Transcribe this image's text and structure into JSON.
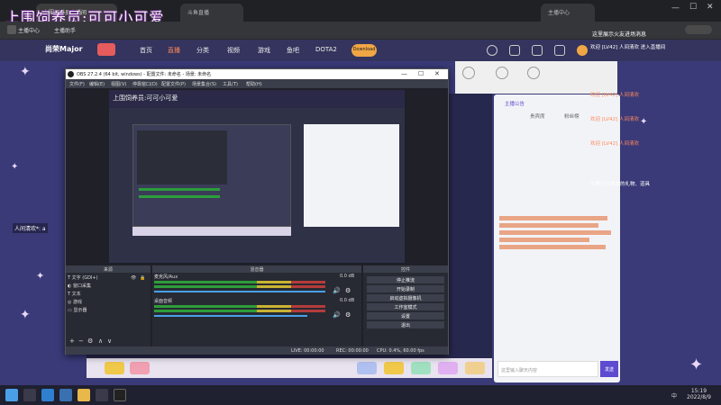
{
  "watermark": "上围饲养员:可可小可爱",
  "browser": {
    "tabs": [
      "上围饲养员直播间",
      "斗鱼直播",
      "主播中心"
    ],
    "bookmarks": [
      "主播中心",
      "主播助手"
    ],
    "address": "douyu.com"
  },
  "site_nav": {
    "logo": "尚荣Major",
    "links": [
      "首页",
      "直播",
      "分类",
      "视频",
      "游戏",
      "鱼吧",
      "DOTA2"
    ],
    "download_label": "Download"
  },
  "chat": {
    "tabs": [
      "主播公告",
      "贵宾席",
      "粉丝榜"
    ],
    "notice": "这里展示火友进场消息",
    "join_lines": [
      "欢迎 [LV42] 人间清欢 进入直播间",
      "欢迎 [LV42] 人间清欢",
      "欢迎 [LV42] 人间清欢",
      "欢迎 [LV42] 人间清欢"
    ],
    "gift_line": "可爱小可收到的礼物、道具",
    "input_placeholder": "这里输入聊天内容",
    "send_label": "发送"
  },
  "overlay_message": "人间清欢*: a",
  "obs": {
    "title": "OBS 27.2.4 (64 bit, windows) - 配置文件: 未命名 - 场景: 未命名",
    "menu": [
      "文件(F)",
      "编辑(E)",
      "视图(V)",
      "停靠窗口(D)",
      "配置文件(P)",
      "场景集合(S)",
      "工具(T)",
      "帮助(H)"
    ],
    "docks": {
      "sources": "来源",
      "mixer": "混音器",
      "controls": "控件"
    },
    "sources": [
      "文字 (GDI+)",
      "窗口采集",
      "文本",
      "游戏",
      "显示器"
    ],
    "mixer_tracks": [
      {
        "name": "桌面音频",
        "db": "0.0 dB"
      },
      {
        "name": "麦克风/Aux",
        "db": "0.0 dB"
      }
    ],
    "controls": [
      "停止推流",
      "开始录制",
      "启动虚拟摄像机",
      "工作室模式",
      "设置",
      "退出"
    ],
    "status": {
      "live": "LIVE: 00:00:00",
      "rec": "REC: 00:00:00",
      "cpu": "CPU: 0.4%, 60.00 fps"
    }
  },
  "taskbar": {
    "time": "15:19",
    "date": "2022/8/9",
    "lang": "中"
  },
  "colors": {
    "site_bg": "#3a3a78",
    "nav_bg": "#34345e",
    "accent": "#5d4bd0"
  }
}
